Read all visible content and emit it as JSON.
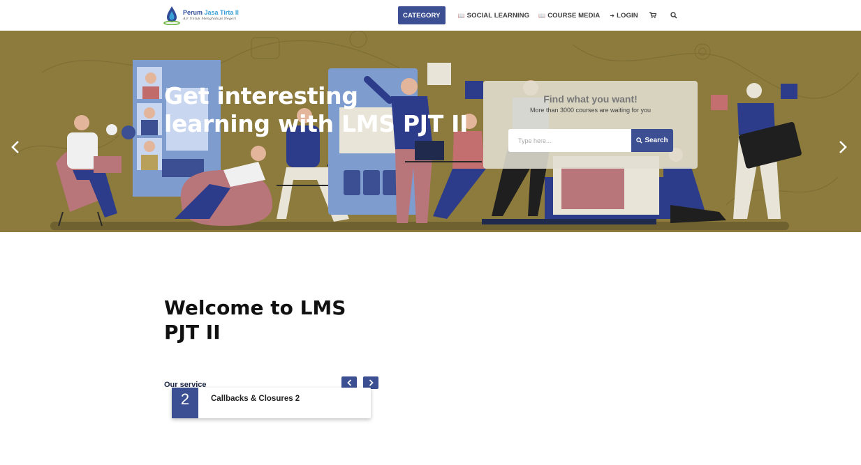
{
  "header": {
    "logo": {
      "title_main": "Perum ",
      "title_accent": "Jasa Tirta II",
      "tagline": "Air Untuk Menghidupi Negeri"
    },
    "nav": {
      "category": "CATEGORY",
      "social_learning": "SOCIAL LEARNING",
      "course_media": "COURSE MEDIA",
      "login": "LOGIN"
    },
    "icons": {
      "social_learning": "book-icon",
      "course_media": "book-icon",
      "login": "sign-in-icon",
      "cart": "cart-icon",
      "search": "search-icon"
    }
  },
  "hero": {
    "title": "Get interesting learning with LMS PJT II",
    "search_panel": {
      "title": "Find what you want!",
      "subtitle": "More than 3000 courses are waiting for you",
      "input_placeholder": "Type here...",
      "input_value": "",
      "button_label": "Search"
    },
    "background_color": "#8c7b3c"
  },
  "main": {
    "welcome_title": "Welcome to LMS PJT II",
    "service_label": "Our service",
    "service_card": {
      "number": "2",
      "title": "Callbacks & Closures 2"
    }
  },
  "colors": {
    "accent": "#3b4f92",
    "hero_bg": "#8c7b3c"
  }
}
